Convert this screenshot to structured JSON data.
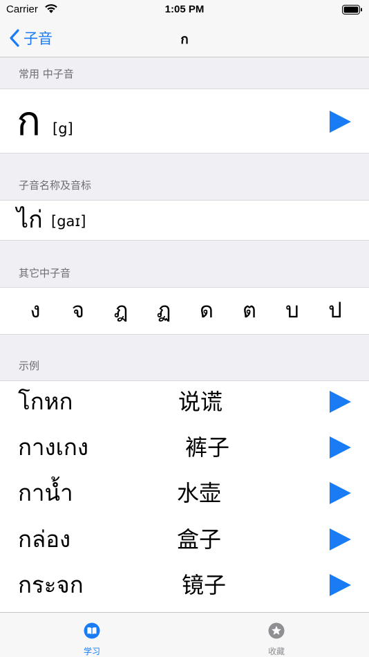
{
  "status_bar": {
    "carrier": "Carrier",
    "time": "1:05 PM"
  },
  "nav": {
    "back_label": "子音",
    "title": "ก"
  },
  "main": {
    "consonant_section": {
      "header": "常用  中子音",
      "character": "ก",
      "ipa": "[g]"
    },
    "name_section": {
      "header": "子音名称及音标",
      "name": "ไก่",
      "ipa": "[gaɪ]"
    },
    "others_section": {
      "header": "其它中子音",
      "items": [
        "ง",
        "จ",
        "ฎ",
        "ฏ",
        "ด",
        "ต",
        "บ",
        "ป"
      ]
    },
    "examples_section": {
      "header": "示例",
      "items": [
        {
          "thai": "โกหก",
          "chinese": "说谎"
        },
        {
          "thai": "กางเกง",
          "chinese": "裤子"
        },
        {
          "thai": "กาน้ำ",
          "chinese": "水壶"
        },
        {
          "thai": "กล่อง",
          "chinese": "盒子"
        },
        {
          "thai": "กระจก",
          "chinese": "镜子"
        }
      ]
    }
  },
  "tab_bar": {
    "tabs": [
      {
        "label": "学习",
        "icon": "book-icon",
        "active": true
      },
      {
        "label": "收藏",
        "icon": "star-icon",
        "active": false
      }
    ]
  },
  "colors": {
    "accent": "#1a7cf4",
    "inactive": "#8e8e93",
    "background": "#efeff4"
  }
}
